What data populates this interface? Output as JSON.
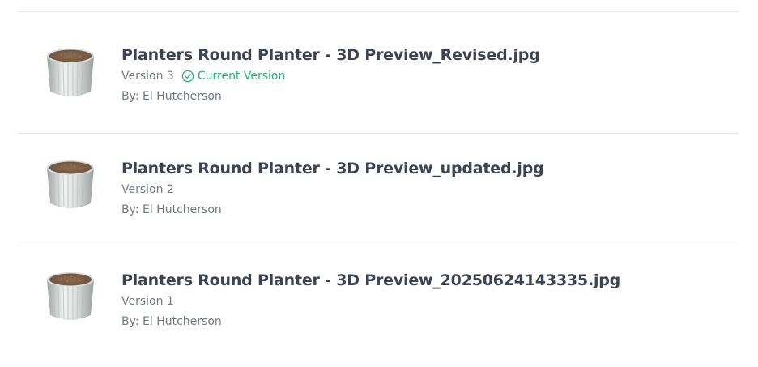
{
  "versions": [
    {
      "title": "Planters Round Planter - 3D Preview_Revised.jpg",
      "version": "Version 3",
      "current_label": "Current Version",
      "author": "By: El Hutcherson",
      "thumbnail_icon": "planter-thumbnail"
    },
    {
      "title": "Planters Round Planter - 3D Preview_updated.jpg",
      "version": "Version 2",
      "current_label": "",
      "author": "By: El Hutcherson",
      "thumbnail_icon": "planter-thumbnail"
    },
    {
      "title": "Planters Round Planter - 3D Preview_20250624143335.jpg",
      "version": "Version 1",
      "current_label": "",
      "author": "By: El Hutcherson",
      "thumbnail_icon": "planter-thumbnail"
    }
  ],
  "colors": {
    "title": "#3d4354",
    "meta": "#737884",
    "current_version": "#22b573",
    "divider": "#e7e7ea"
  },
  "icons": {
    "current_badge": "check-circle-icon"
  }
}
